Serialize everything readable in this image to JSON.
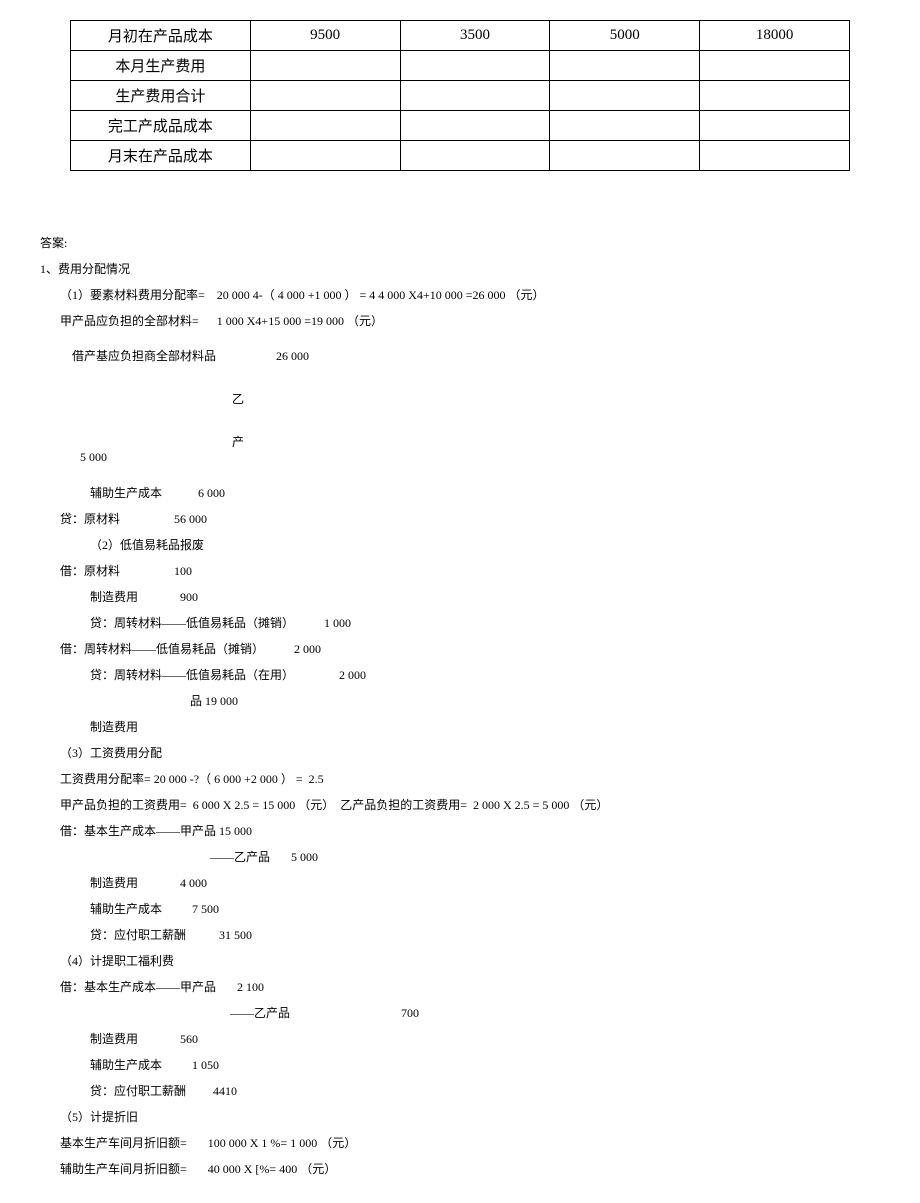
{
  "table": {
    "rows": [
      {
        "label": "月初在产品成本",
        "c1": "9500",
        "c2": "3500",
        "c3": "5000",
        "c4": "18000"
      },
      {
        "label": "本月生产费用",
        "c1": "",
        "c2": "",
        "c3": "",
        "c4": ""
      },
      {
        "label": "生产费用合计",
        "c1": "",
        "c2": "",
        "c3": "",
        "c4": ""
      },
      {
        "label": "完工产成品成本",
        "c1": "",
        "c2": "",
        "c3": "",
        "c4": ""
      },
      {
        "label": "月末在产品成本",
        "c1": "",
        "c2": "",
        "c3": "",
        "c4": ""
      }
    ]
  },
  "lines": {
    "l0": "答案:",
    "l1": "1、费用分配情况",
    "l2": "（1）要素材料费用分配率=    20 000 4-（ 4 000 +1 000 ） = 4 4 000 X4+10 000 =26 000 （元）",
    "l3": "甲产品应负担的全部材料=      1 000 X4+15 000 =19 000 （元）",
    "l4a": "借产基应负担商全部材料品",
    "l4b": "26 000",
    "l4c": "乙",
    "l4d": "产",
    "l4e": "5 000",
    "l5": "辅助生产成本            6 000",
    "l6": "贷：原材料                  56 000",
    "l7": "（2）低值易耗品报废",
    "l8": "借：原材料                  100",
    "l9": "制造费用              900",
    "l10": "贷：周转材料——低值易耗品（摊销）          1 000",
    "l11": "借：周转材料——低值易耗品（摊销）          2 000",
    "l12": "贷：周转材料——低值易耗品（在用）               2 000",
    "l12b": "品 19 000",
    "l13": "制造费用",
    "l14": "（3）工资费用分配",
    "l15": "工资费用分配率= 20 000 -?（ 6 000 +2 000 ） =  2.5",
    "l16": "甲产品负担的工资费用=  6 000 X 2.5 = 15 000 （元）  乙产品负担的工资费用=  2 000 X 2.5 = 5 000 （元）",
    "l17": "借：基本生产成本——甲产品 15 000",
    "l18": "——乙产品       5 000",
    "l19": "制造费用              4 000",
    "l20": "辅助生产成本          7 500",
    "l21": "贷：应付职工薪酬           31 500",
    "l22": "（4）计提职工福利费",
    "l23": "借：基本生产成本——甲产品       2 100",
    "l24": "——乙产品                                     700",
    "l25": "制造费用              560",
    "l26": "辅助生产成本          1 050",
    "l27": "贷：应付职工薪酬         4410",
    "l28": "（5）计提折旧",
    "l29": "基本生产车间月折旧额=       100 000 X 1 %= 1 000 （元）",
    "l30": "辅助生产车间月折旧额=       40 000 X [%= 400 （元）"
  }
}
